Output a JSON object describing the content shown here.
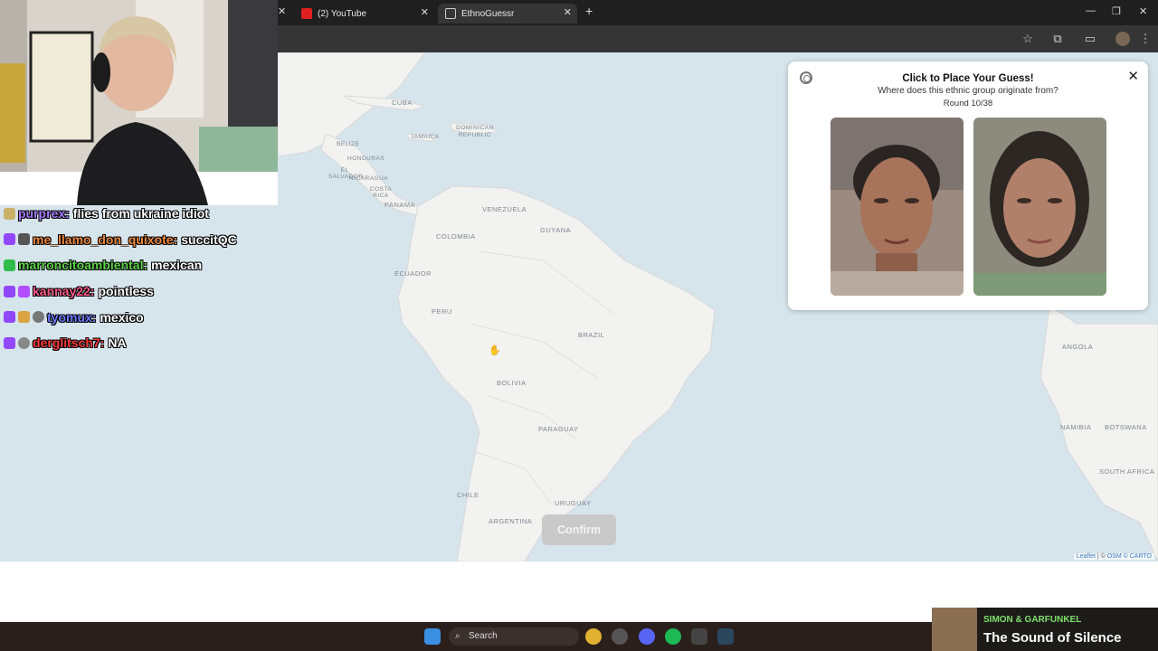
{
  "browser": {
    "tabs": [
      {
        "label": "(2) YouTube",
        "active": false
      },
      {
        "label": "EthnoGuessr",
        "active": true
      }
    ],
    "new_tab": "+"
  },
  "map": {
    "labels": [
      "CUBA",
      "JAMAICA",
      "DOMINICAN REPUBLIC",
      "BELIZE",
      "HONDURAS",
      "EL SALVADOR",
      "NICARAGUA",
      "COSTA RICA",
      "PANAMA",
      "VENEZUELA",
      "GUYANA",
      "COLOMBIA",
      "ECUADOR",
      "PERU",
      "BRAZIL",
      "BOLIVIA",
      "PARAGUAY",
      "CHILE",
      "URUGUAY",
      "ARGENTINA",
      "ANGOLA",
      "NAMIBIA",
      "BOTSWANA",
      "SOUTH AFRICA"
    ],
    "attribution": {
      "leaflet": "Leaflet",
      "sep": " | © ",
      "osm": "OSM",
      "carto": "© CARTO"
    }
  },
  "panel": {
    "title": "Click to Place Your Guess!",
    "subtitle": "Where does this ethnic group originate from?",
    "round": "Round 10/38",
    "close": "✕"
  },
  "confirm_label": "Confirm",
  "chat": [
    {
      "user": "purprex:",
      "msg": "flies from ukraine idiot",
      "color": "#a77bff"
    },
    {
      "user": "me_llamo_don_quixote:",
      "msg": "succitQC",
      "color": "#f08a3c"
    },
    {
      "user": "marroncitoambiental:",
      "msg": "mexican",
      "color": "#5fd34a"
    },
    {
      "user": "kannay22:",
      "msg": "pointless",
      "color": "#ff5a8a"
    },
    {
      "user": "tyomux:",
      "msg": "mexico",
      "color": "#6d7cff"
    },
    {
      "user": "derglitsch7:",
      "msg": "NA",
      "color": "#ff3b3b"
    }
  ],
  "taskbar": {
    "search": "Search"
  },
  "now_playing": {
    "artist": "SIMON & GARFUNKEL",
    "song": "The Sound of Silence"
  }
}
